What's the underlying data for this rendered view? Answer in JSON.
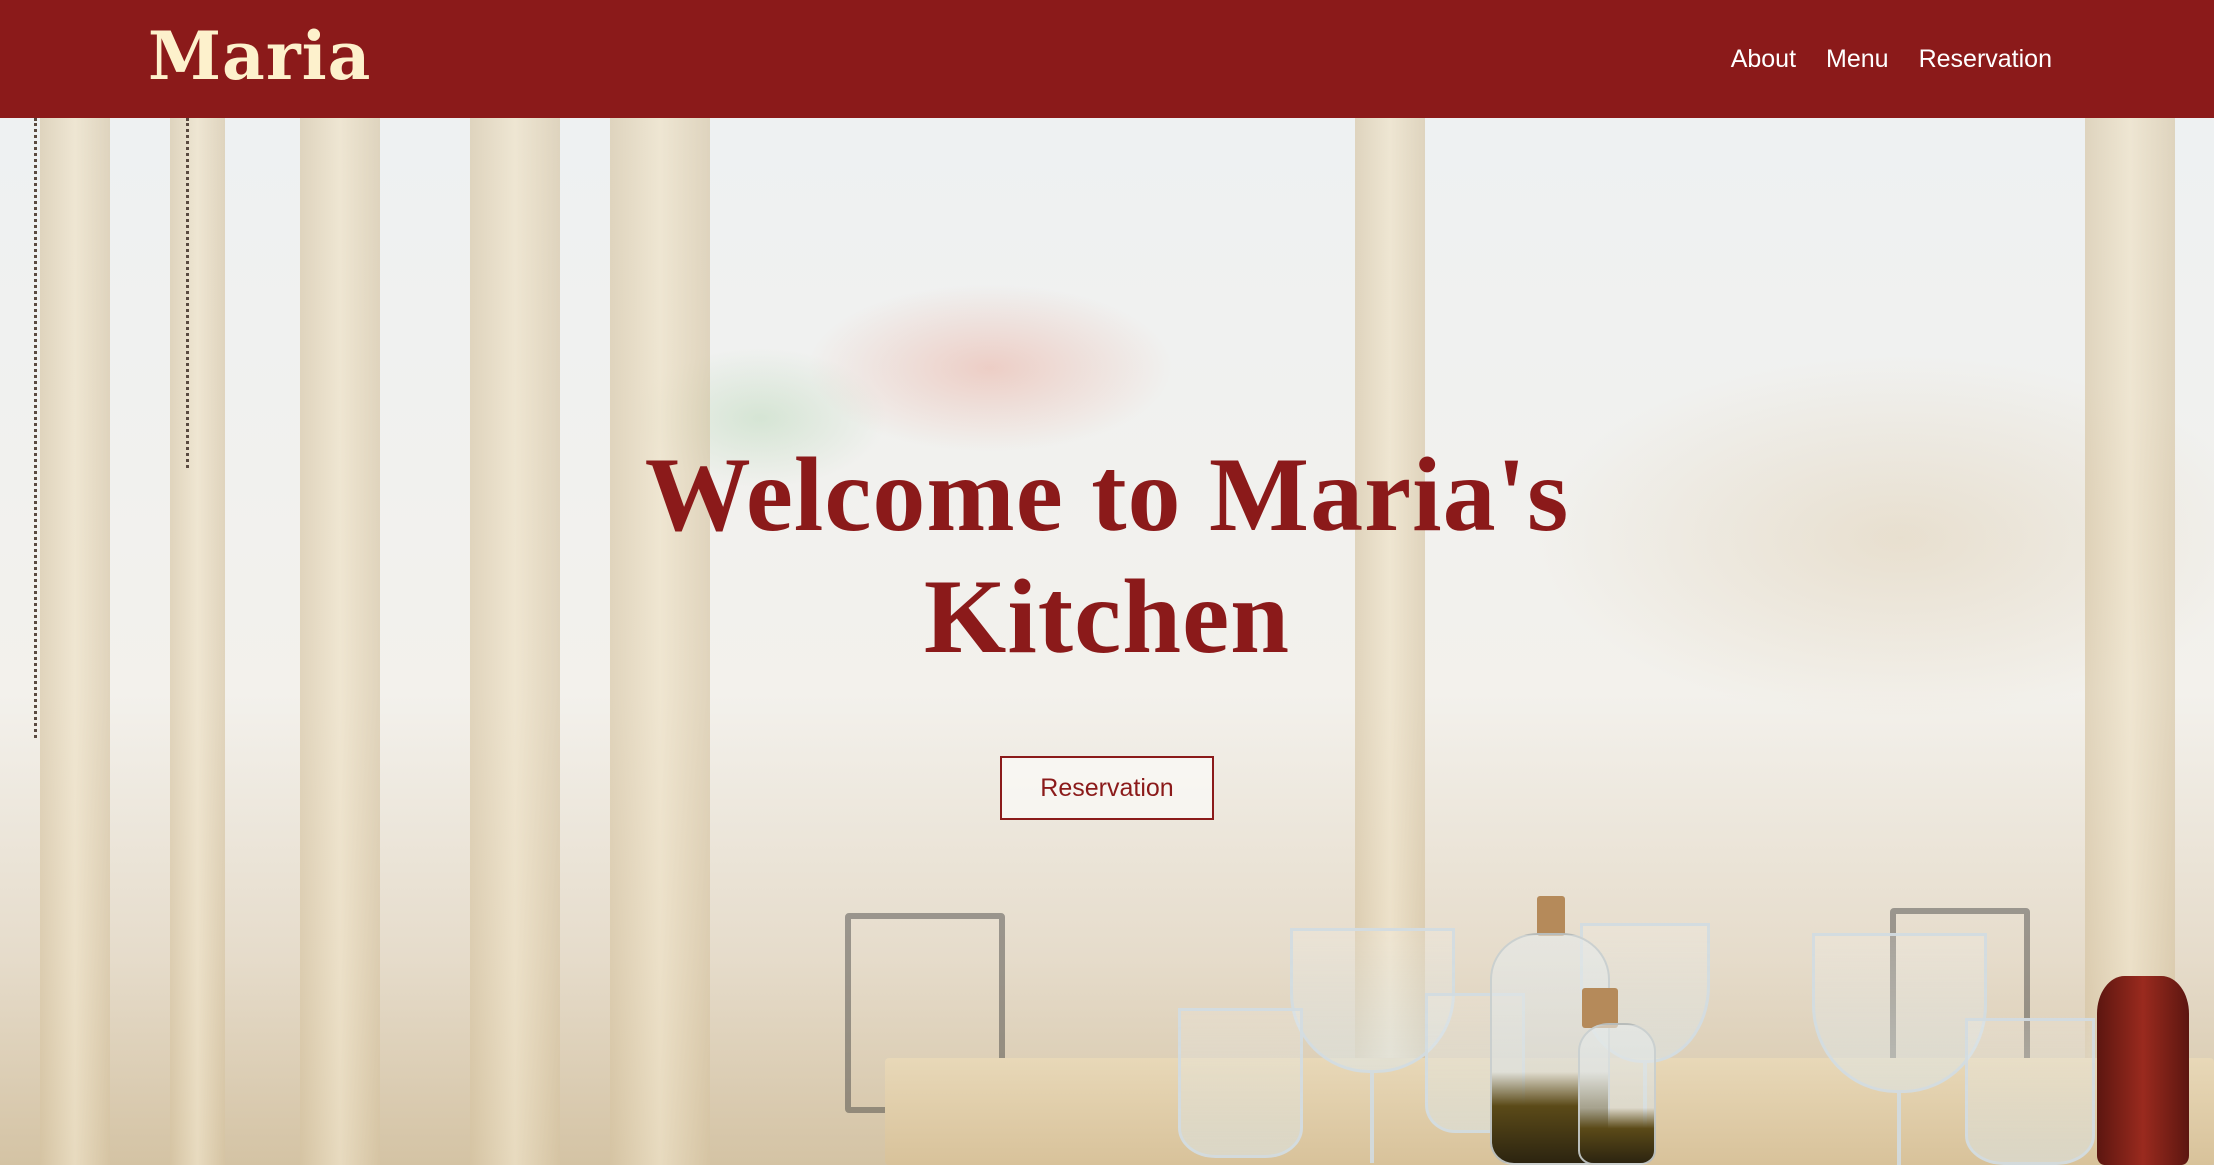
{
  "navbar": {
    "brand": "Maria",
    "links": [
      {
        "label": "About"
      },
      {
        "label": "Menu"
      },
      {
        "label": "Reservation"
      }
    ]
  },
  "hero": {
    "title": "Welcome to Maria's Kitchen",
    "button_label": "Reservation"
  },
  "colors": {
    "brand": "#8b1a1a",
    "brand_text": "#fdf1cc",
    "nav_text": "#ffffff"
  }
}
